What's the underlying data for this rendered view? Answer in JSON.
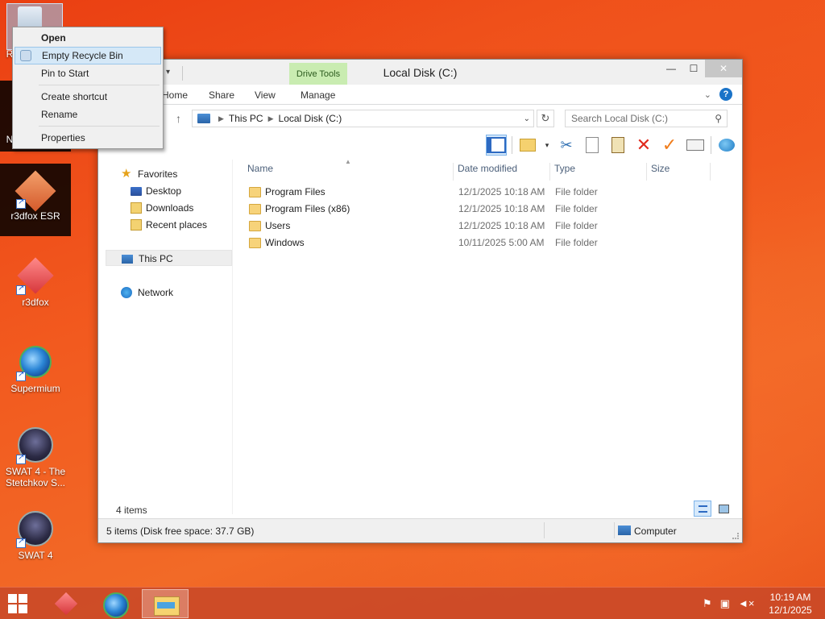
{
  "desktop": {
    "icons": [
      {
        "label": "R",
        "icon": "recycle-bin-icon"
      },
      {
        "label": "N",
        "icon": "network-icon"
      },
      {
        "label": "r3dfox ESR",
        "icon": "r3dfox-esr-icon"
      },
      {
        "label": "r3dfox",
        "icon": "r3dfox-icon"
      },
      {
        "label": "Supermium",
        "icon": "supermium-icon"
      },
      {
        "label": "SWAT 4 - The Stetchkov S...",
        "icon": "swat4-icon"
      },
      {
        "label": "SWAT 4",
        "icon": "swat4-icon"
      }
    ]
  },
  "context_menu": {
    "items": [
      "Open",
      "Empty Recycle Bin",
      "Pin to Start",
      "Create shortcut",
      "Rename",
      "Properties"
    ]
  },
  "window": {
    "title": "Local Disk (C:)",
    "contextual_tab": "Drive Tools",
    "tabs": [
      "Home",
      "Share",
      "View",
      "Manage"
    ],
    "address": {
      "crumbs": [
        "This PC",
        "Local Disk (C:)"
      ]
    },
    "search": {
      "placeholder": "Search Local Disk (C:)"
    },
    "nav": {
      "favorites": "Favorites",
      "favorites_items": [
        "Desktop",
        "Downloads",
        "Recent places"
      ],
      "this_pc": "This PC",
      "network": "Network"
    },
    "columns": [
      "Name",
      "Date modified",
      "Type",
      "Size"
    ],
    "files": [
      {
        "name": "Program Files",
        "date": "12/1/2025 10:18 AM",
        "type": "File folder"
      },
      {
        "name": "Program Files (x86)",
        "date": "12/1/2025 10:18 AM",
        "type": "File folder"
      },
      {
        "name": "Users",
        "date": "12/1/2025 10:18 AM",
        "type": "File folder"
      },
      {
        "name": "Windows",
        "date": "10/11/2025 5:00 AM",
        "type": "File folder"
      }
    ],
    "item_count": "4 items",
    "status_left": "5 items (Disk free space: 37.7 GB)",
    "status_right": "Computer"
  },
  "taskbar": {
    "time": "10:19 AM",
    "date": "12/1/2025"
  },
  "colors": {
    "accent": "#1a73c8",
    "drive_tools_tab": "#c9ecb1",
    "desktop": "#f25a1f"
  }
}
